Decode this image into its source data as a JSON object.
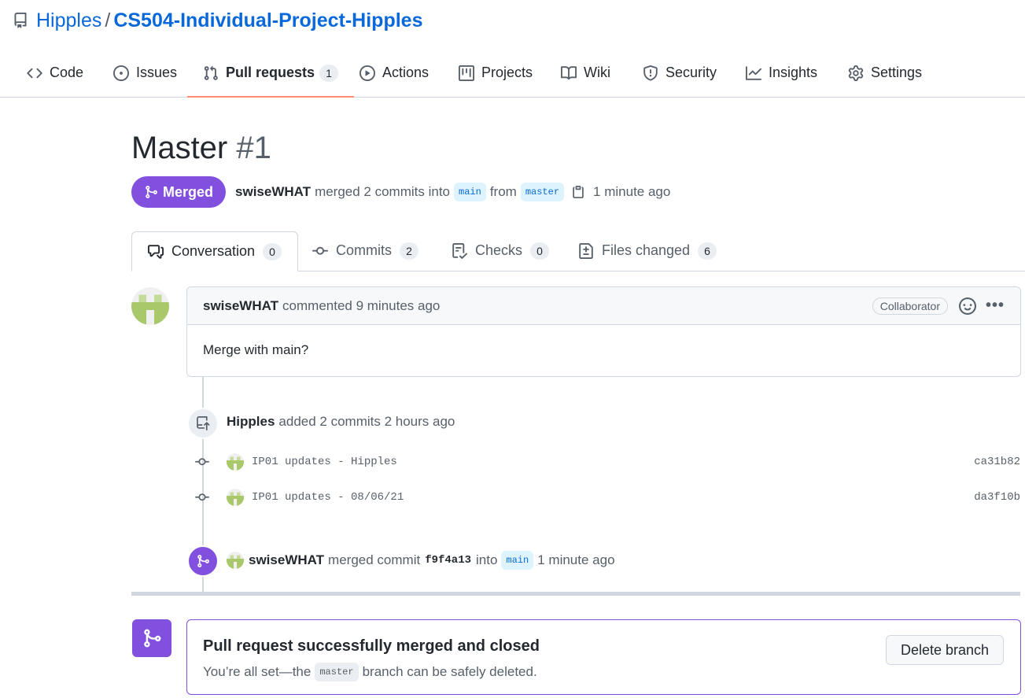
{
  "repo": {
    "owner": "Hipples",
    "separator": "/",
    "name": "CS504-Individual-Project-Hipples",
    "icon": "repo-icon"
  },
  "nav": {
    "items": [
      {
        "label": "Code",
        "icon": "code-icon"
      },
      {
        "label": "Issues",
        "icon": "issue-icon"
      },
      {
        "label": "Pull requests",
        "icon": "pull-request-icon",
        "count": "1",
        "active": true
      },
      {
        "label": "Actions",
        "icon": "play-icon"
      },
      {
        "label": "Projects",
        "icon": "project-icon"
      },
      {
        "label": "Wiki",
        "icon": "book-icon"
      },
      {
        "label": "Security",
        "icon": "shield-icon"
      },
      {
        "label": "Insights",
        "icon": "graph-icon"
      },
      {
        "label": "Settings",
        "icon": "gear-icon"
      }
    ]
  },
  "pr": {
    "title": "Master",
    "number": "#1",
    "state": "Merged",
    "author": "swiseWHAT",
    "merged_text": "merged 2 commits into",
    "base_branch": "main",
    "from_text": "from",
    "head_branch": "master",
    "time": "1 minute ago"
  },
  "tabs": [
    {
      "label": "Conversation",
      "count": "0",
      "icon": "comment-discussion-icon"
    },
    {
      "label": "Commits",
      "count": "2",
      "icon": "commit-icon"
    },
    {
      "label": "Checks",
      "count": "0",
      "icon": "checklist-icon"
    },
    {
      "label": "Files changed",
      "count": "6",
      "icon": "file-diff-icon"
    }
  ],
  "comment": {
    "author": "swiseWHAT",
    "action": "commented 9 minutes ago",
    "badge": "Collaborator",
    "body": "Merge with main?"
  },
  "timeline": {
    "commits_event": {
      "author": "Hipples",
      "text": "added 2 commits 2 hours ago"
    },
    "commits": [
      {
        "message": "IP01 updates - Hipples",
        "sha": "ca31b82"
      },
      {
        "message": "IP01 updates - 08/06/21",
        "sha": "da3f10b"
      }
    ],
    "merge_event": {
      "author": "swiseWHAT",
      "text_before": "merged commit",
      "sha": "f9f4a13",
      "text_into": "into",
      "branch": "main",
      "time": "1 minute ago"
    }
  },
  "merge_box": {
    "title": "Pull request successfully merged and closed",
    "sub_before": "You’re all set—the",
    "branch": "master",
    "sub_after": "branch can be safely deleted.",
    "button": "Delete branch"
  },
  "colors": {
    "accent": "#0969da",
    "merged": "#8250df",
    "nav_underline": "#fd8c73"
  }
}
